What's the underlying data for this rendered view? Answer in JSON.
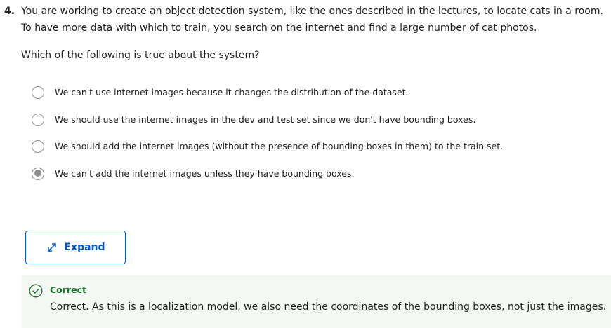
{
  "question": {
    "number": "4.",
    "text": "You are working to create an object detection system, like the ones described in the lectures, to locate cats in a room. To have more data with which to train, you search on the internet and find a large number of cat photos.",
    "prompt": "Which of the following is true about the system?"
  },
  "options": [
    {
      "label": "We can't use internet images because it changes the distribution of the dataset.",
      "selected": false
    },
    {
      "label": "We should use the internet images in the dev and test set since we don't have bounding boxes.",
      "selected": false
    },
    {
      "label": "We should add the internet images (without the presence of bounding boxes in them) to the train set.",
      "selected": false
    },
    {
      "label": "We can't add the internet images unless they have bounding boxes.",
      "selected": true
    }
  ],
  "expand_button": {
    "label": "Expand",
    "icon": "expand-arrows-icon"
  },
  "feedback": {
    "icon": "check-circle-icon",
    "title": "Correct",
    "text": "Correct. As this is a localization model, we also need the coordinates of the bounding boxes, not just the images."
  },
  "colors": {
    "accent": "#0056d2",
    "correct": "#1e6f2e",
    "feedback_bg": "#f3f8f3",
    "radio": "#8f8f8f"
  }
}
